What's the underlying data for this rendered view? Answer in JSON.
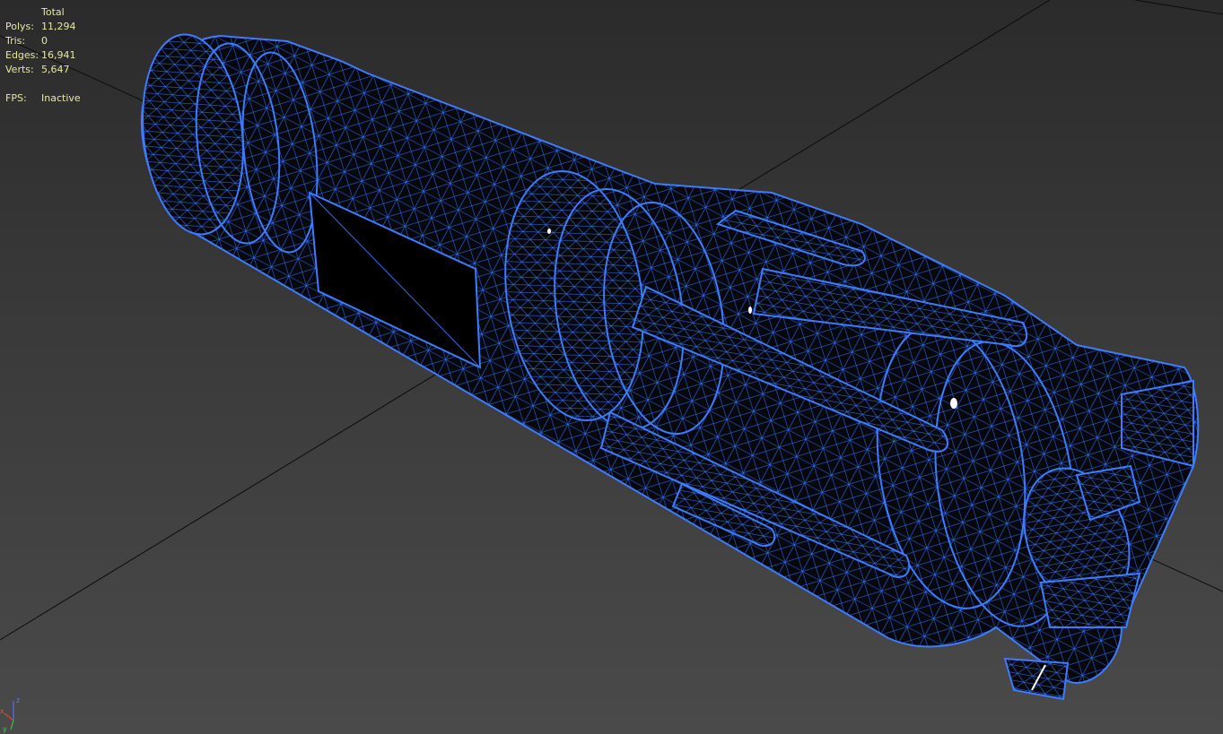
{
  "stats": {
    "header": "Total",
    "rows": [
      {
        "label": "Polys:",
        "value": "11,294"
      },
      {
        "label": "Tris:",
        "value": "0"
      },
      {
        "label": "Edges:",
        "value": "16,941"
      },
      {
        "label": "Verts:",
        "value": "5,647"
      }
    ],
    "fps_label": "FPS:",
    "fps_value": "Inactive"
  },
  "gizmo": {
    "x": "x",
    "y": "y",
    "z": "z"
  },
  "colors": {
    "stats_text": "#e8e8a0",
    "wire": "#3d7bff",
    "mesh": "#050608",
    "grid": "#0c0c0c",
    "viewport_top": "#2b2b2b",
    "viewport_bottom": "#4a4a4a"
  }
}
